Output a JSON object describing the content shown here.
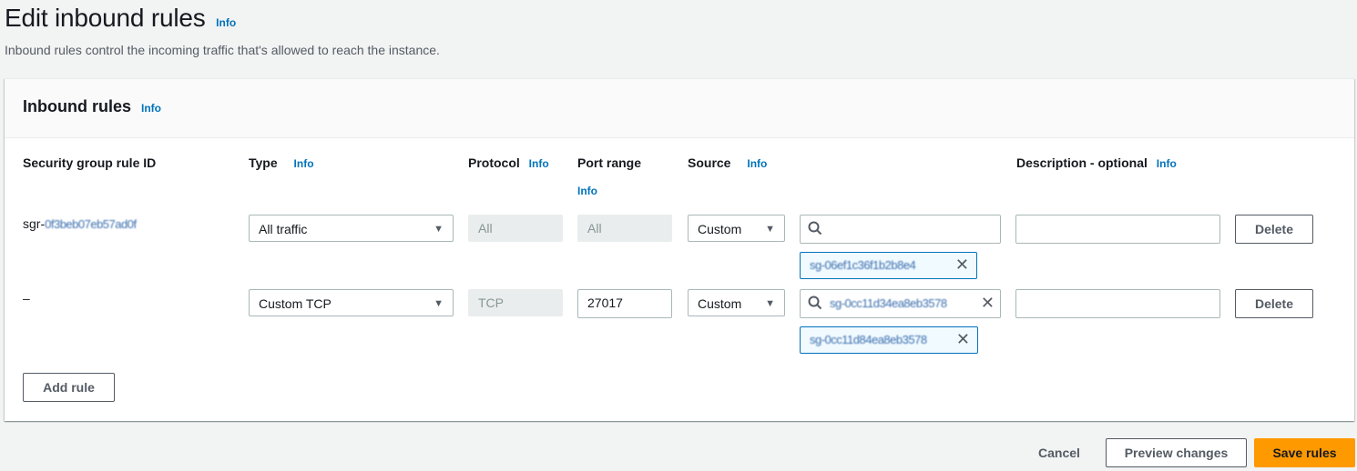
{
  "page": {
    "title": "Edit inbound rules",
    "title_info": "Info",
    "description": "Inbound rules control the incoming traffic that's allowed to reach the instance."
  },
  "card": {
    "title": "Inbound rules",
    "info": "Info",
    "columns": {
      "rule_id": "Security group rule ID",
      "type": "Type",
      "type_info": "Info",
      "protocol": "Protocol",
      "protocol_info": "Info",
      "port_range": "Port range",
      "port_range_info": "Info",
      "source": "Source",
      "source_info": "Info",
      "description": "Description - optional",
      "description_info": "Info"
    },
    "rules": [
      {
        "rule_id": "sgr-0f3beb07eb57ad0f",
        "type": "All traffic",
        "protocol": "All",
        "port_range": "All",
        "source": "Custom",
        "source_search_value": "",
        "source_tokens": [
          "sg-06ef1c36f1b2b8e4"
        ],
        "description": "",
        "delete_label": "Delete"
      },
      {
        "rule_id": "–",
        "type": "Custom TCP",
        "protocol": "TCP",
        "port_range": "27017",
        "source": "Custom",
        "source_search_value": "sg-0cc11d34ea8eb3578",
        "source_tokens": [
          "sg-0cc11d84ea8eb3578"
        ],
        "description": "",
        "delete_label": "Delete"
      }
    ],
    "add_rule_label": "Add rule"
  },
  "footer": {
    "cancel_label": "Cancel",
    "preview_label": "Preview changes",
    "save_label": "Save rules"
  },
  "colors": {
    "link": "#0073bb",
    "primary": "#ff9900",
    "token_border": "#0073bb"
  }
}
